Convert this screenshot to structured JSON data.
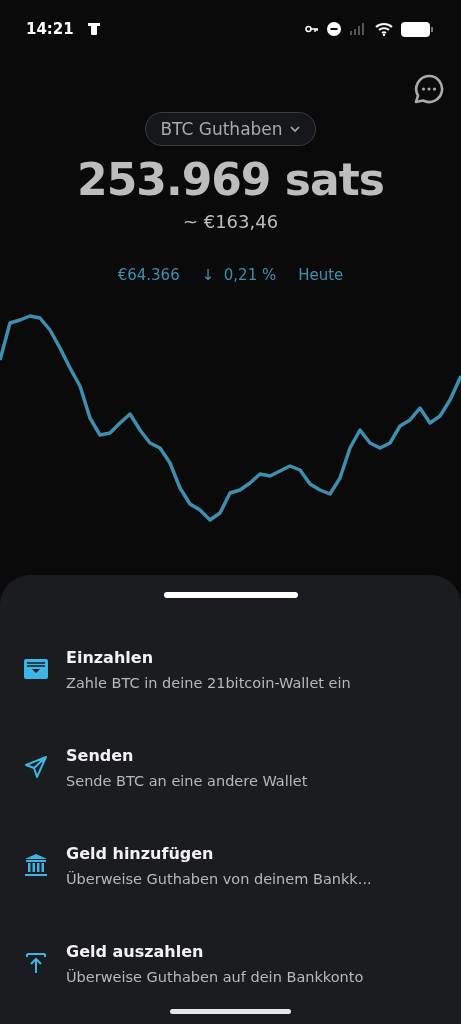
{
  "status_bar": {
    "time": "14:21"
  },
  "balance": {
    "selector": "BTC Guthaben",
    "amount": "253.969 sats",
    "fiat": "~ €163,46"
  },
  "price": {
    "value": "€64.366",
    "arrow": "↓",
    "change": "0,21 %",
    "period": "Heute"
  },
  "actions": [
    {
      "title": "Einzahlen",
      "subtitle": "Zahle BTC in deine 21bitcoin-Wallet ein"
    },
    {
      "title": "Senden",
      "subtitle": "Sende BTC an eine andere Wallet"
    },
    {
      "title": "Geld hinzufügen",
      "subtitle": "Überweise Guthaben von deinem Bankk..."
    },
    {
      "title": "Geld auszahlen",
      "subtitle": "Überweise Guthaben auf dein Bankkonto"
    }
  ]
}
